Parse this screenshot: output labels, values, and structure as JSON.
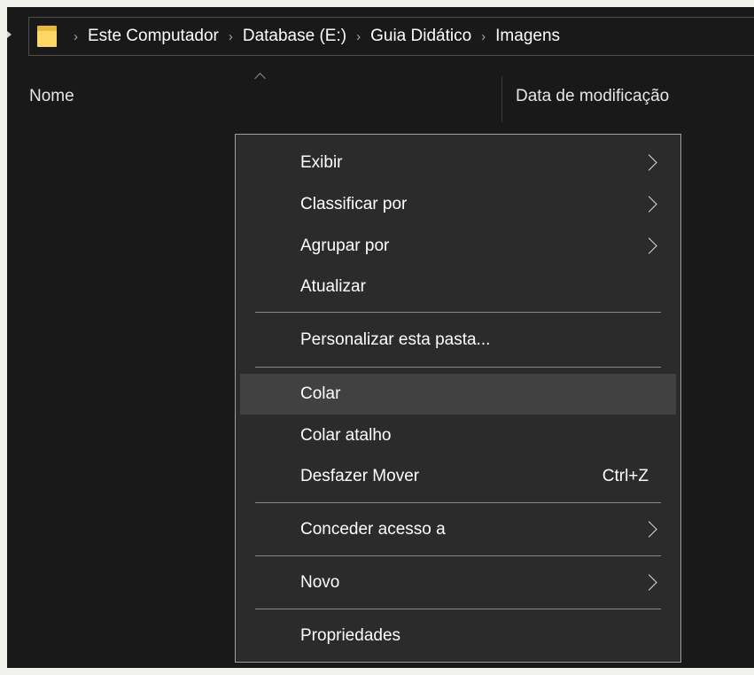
{
  "breadcrumb": {
    "items": [
      "Este Computador",
      "Database (E:)",
      "Guia Didático",
      "Imagens"
    ],
    "separator": "›"
  },
  "columns": {
    "name": "Nome",
    "date_modified": "Data de modificação"
  },
  "context_menu": {
    "items": [
      {
        "label": "Exibir",
        "has_submenu": true
      },
      {
        "label": "Classificar por",
        "has_submenu": true
      },
      {
        "label": "Agrupar por",
        "has_submenu": true
      },
      {
        "label": "Atualizar"
      },
      {
        "label": "Personalizar esta pasta..."
      },
      {
        "label": "Colar",
        "highlighted": true
      },
      {
        "label": "Colar atalho"
      },
      {
        "label": "Desfazer Mover",
        "shortcut": "Ctrl+Z"
      },
      {
        "label": "Conceder acesso a",
        "has_submenu": true
      },
      {
        "label": "Novo",
        "has_submenu": true
      },
      {
        "label": "Propriedades"
      }
    ]
  },
  "colors": {
    "window_background": "#191919",
    "menu_background": "#2b2b2b",
    "menu_highlight": "#414141",
    "folder_icon": "#ffd766"
  },
  "icons": [
    "folder-icon",
    "chevron-right-icon",
    "sort-ascending-icon"
  ]
}
